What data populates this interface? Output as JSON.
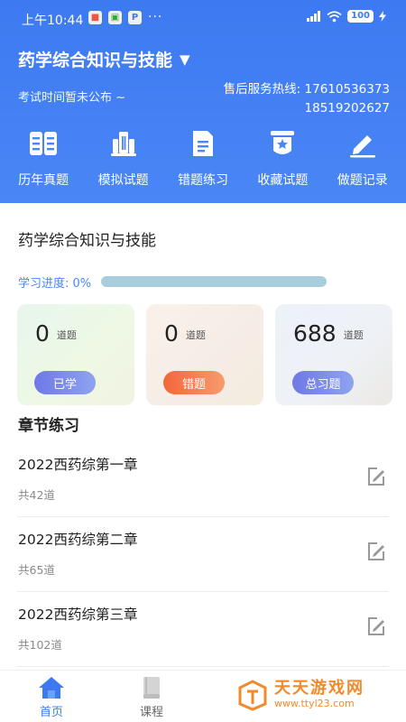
{
  "status_bar": {
    "time": "上午10:44",
    "more": "···",
    "battery": "100"
  },
  "header": {
    "course_name": "药学综合知识与技能",
    "dropdown_caret": "▼",
    "exam_time": "考试时间暂未公布 ~",
    "hotline_label": "售后服务热线: 17610536373",
    "hotline_second": "18519202627"
  },
  "quick_nav": [
    {
      "label": "历年真题",
      "icon": "book-icon"
    },
    {
      "label": "模拟试题",
      "icon": "building-icon"
    },
    {
      "label": "错题练习",
      "icon": "document-icon"
    },
    {
      "label": "收藏试题",
      "icon": "bookmark-star-icon"
    },
    {
      "label": "做题记录",
      "icon": "pencil-icon"
    }
  ],
  "main": {
    "course_title": "药学综合知识与技能",
    "progress_label": "学习进度: 0%",
    "progress_value": 0
  },
  "stats": {
    "learned": {
      "count": "0",
      "unit": "道题",
      "button": "已学"
    },
    "wrong": {
      "count": "0",
      "unit": "道题",
      "button": "错题"
    },
    "total": {
      "count": "688",
      "unit": "道题",
      "button": "总习题"
    }
  },
  "chapters": {
    "heading": "章节练习",
    "items": [
      {
        "name": "2022西药综第一章",
        "count": "共42道"
      },
      {
        "name": "2022西药综第二章",
        "count": "共65道"
      },
      {
        "name": "2022西药综第三章",
        "count": "共102道"
      }
    ]
  },
  "bottom_nav": {
    "home": "首页",
    "course": "课程"
  },
  "watermark": {
    "brand": "天天游戏网",
    "url": "www.ttyl23.com"
  },
  "colors": {
    "primary": "#3d7af2",
    "accent_orange": "#f3663a",
    "progress_track": "#a8cedb"
  }
}
